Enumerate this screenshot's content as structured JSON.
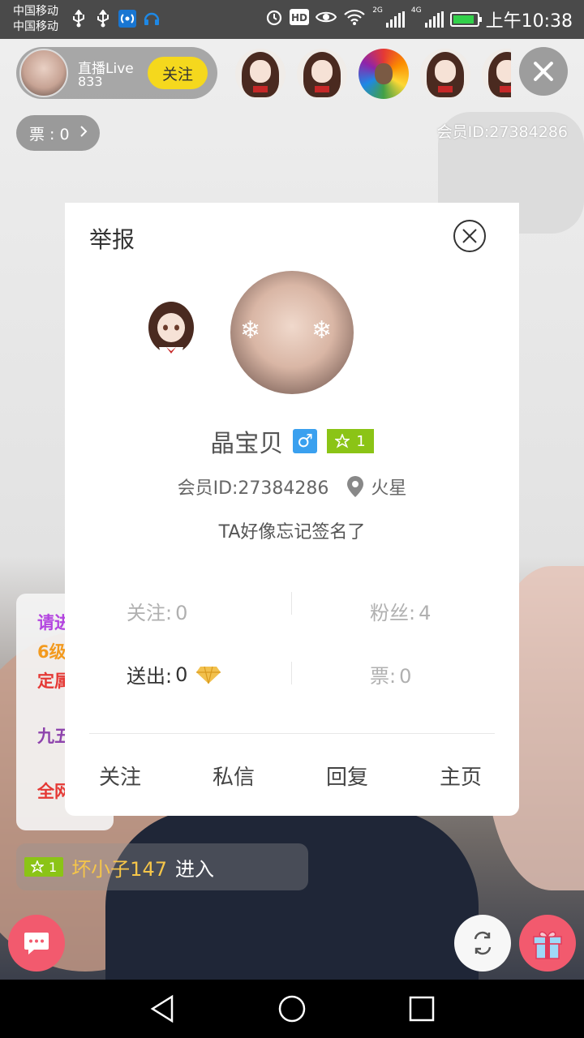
{
  "status_bar": {
    "carrier_1": "中国移动",
    "carrier_2": "中国移动",
    "net_2g": "2G",
    "net_4g": "4G",
    "hd": "HD",
    "time": "上午10:38",
    "battery_level": 0.9,
    "icons": [
      "usb-icon",
      "usb-icon",
      "hotspot-icon",
      "headset-icon",
      "alarm-icon",
      "hd-icon",
      "eye-icon",
      "wifi-icon",
      "signal-icon",
      "signal-icon",
      "battery-icon"
    ]
  },
  "live_header": {
    "anchor_name": "直播Live",
    "anchor_count": "833",
    "follow_label": "关注",
    "ticket_label": "票 : 0",
    "member_id": "会员ID:27384286"
  },
  "viewers": [
    "anime-girl",
    "anime-girl",
    "rainbow-afro",
    "anime-girl",
    "anime-girl"
  ],
  "profile_card": {
    "report_label": "举报",
    "nickname": "晶宝贝",
    "gender_symbol": "♂",
    "level": "1",
    "member_id": "会员ID:27384286",
    "location": "火星",
    "signature": "TA好像忘记签名了",
    "stats": {
      "following_label": "关注:",
      "following_value": "0",
      "fans_label": "粉丝:",
      "fans_value": "4",
      "sent_label": "送出:",
      "sent_value": "0",
      "tickets_label": "票:",
      "tickets_value": "0"
    },
    "actions": {
      "follow": "关注",
      "message": "私信",
      "reply": "回复",
      "homepage": "主页"
    }
  },
  "chat": {
    "partial_lines": [
      "请进",
      "6级",
      "定属",
      "九五",
      "全网"
    ],
    "entry_level": "1",
    "entry_user": "坏小子147",
    "entry_action": "进入"
  },
  "colors": {
    "follow_yellow": "#f5d81d",
    "level_green": "#8bc416",
    "gender_blue": "#3aa0ef",
    "button_pink": "#f25a6e",
    "entry_gold": "#f6c649"
  }
}
